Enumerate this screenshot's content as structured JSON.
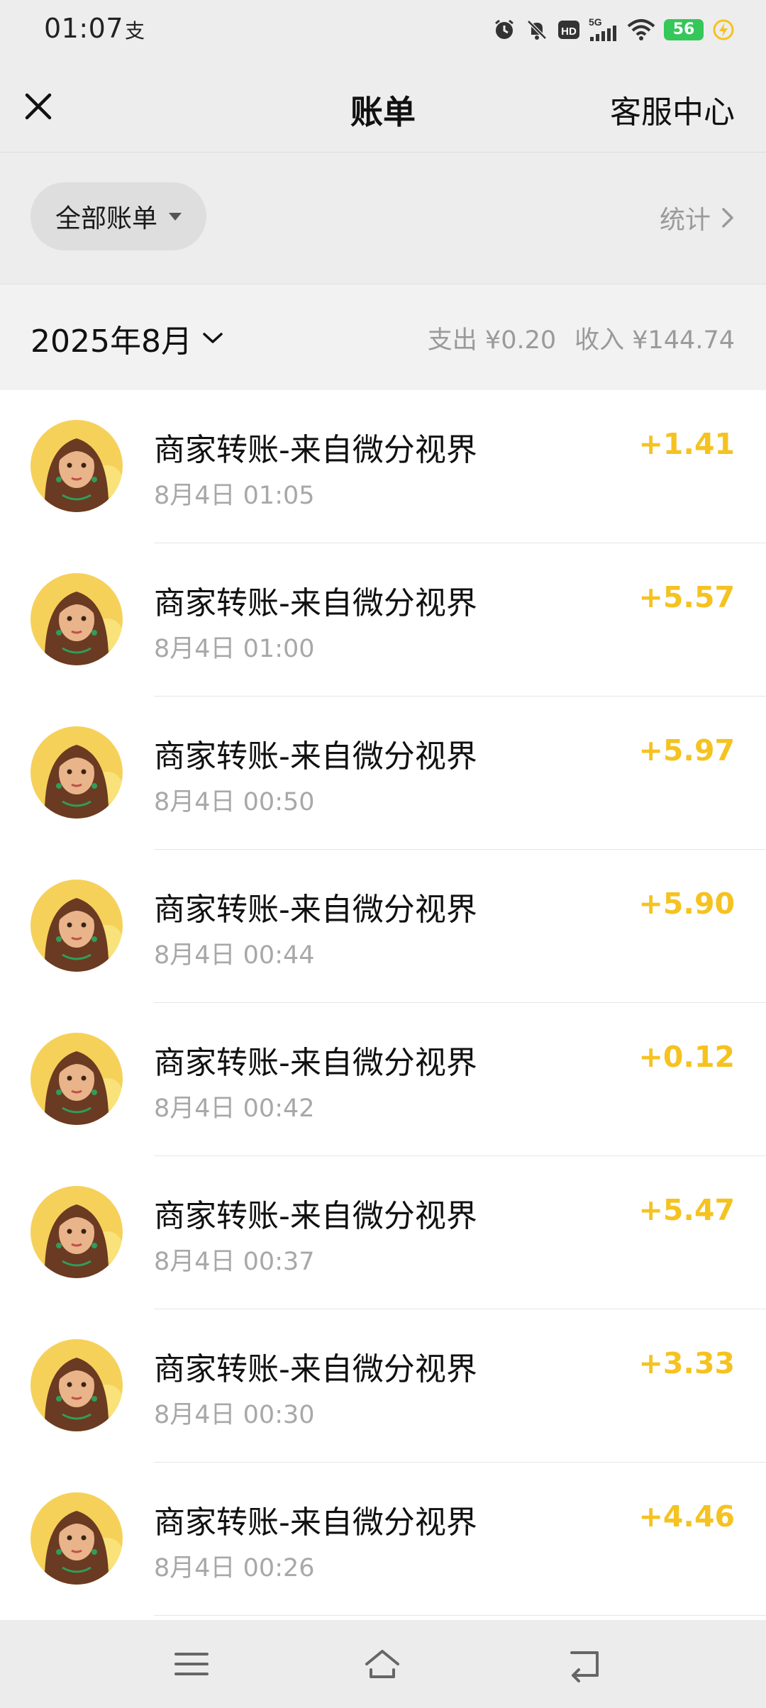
{
  "status_bar": {
    "time": "01:07",
    "app_glyph": "支",
    "network": "5G",
    "hd_label": "HD",
    "battery": "56",
    "icons": [
      "alarm-icon",
      "mute-icon",
      "hd-icon",
      "signal-icon",
      "wifi-icon",
      "battery-icon",
      "charging-icon"
    ]
  },
  "header": {
    "title": "账单",
    "service_label": "客服中心",
    "close_icon": "close-icon"
  },
  "filter": {
    "label": "全部账单",
    "stats_label": "统计"
  },
  "month": {
    "label": "2025年8月",
    "expense": "支出 ¥0.20",
    "income": "收入 ¥144.74"
  },
  "colors": {
    "amount": "#f5c220",
    "background": "#ededed"
  },
  "transactions": [
    {
      "title": "商家转账-来自微分视界",
      "time": "8月4日 01:05",
      "amount": "+1.41"
    },
    {
      "title": "商家转账-来自微分视界",
      "time": "8月4日 01:00",
      "amount": "+5.57"
    },
    {
      "title": "商家转账-来自微分视界",
      "time": "8月4日 00:50",
      "amount": "+5.97"
    },
    {
      "title": "商家转账-来自微分视界",
      "time": "8月4日 00:44",
      "amount": "+5.90"
    },
    {
      "title": "商家转账-来自微分视界",
      "time": "8月4日 00:42",
      "amount": "+0.12"
    },
    {
      "title": "商家转账-来自微分视界",
      "time": "8月4日 00:37",
      "amount": "+5.47"
    },
    {
      "title": "商家转账-来自微分视界",
      "time": "8月4日 00:30",
      "amount": "+3.33"
    },
    {
      "title": "商家转账-来自微分视界",
      "time": "8月4日 00:26",
      "amount": "+4.46"
    }
  ],
  "nav": {
    "icons": [
      "menu-icon",
      "home-icon",
      "back-icon"
    ]
  }
}
